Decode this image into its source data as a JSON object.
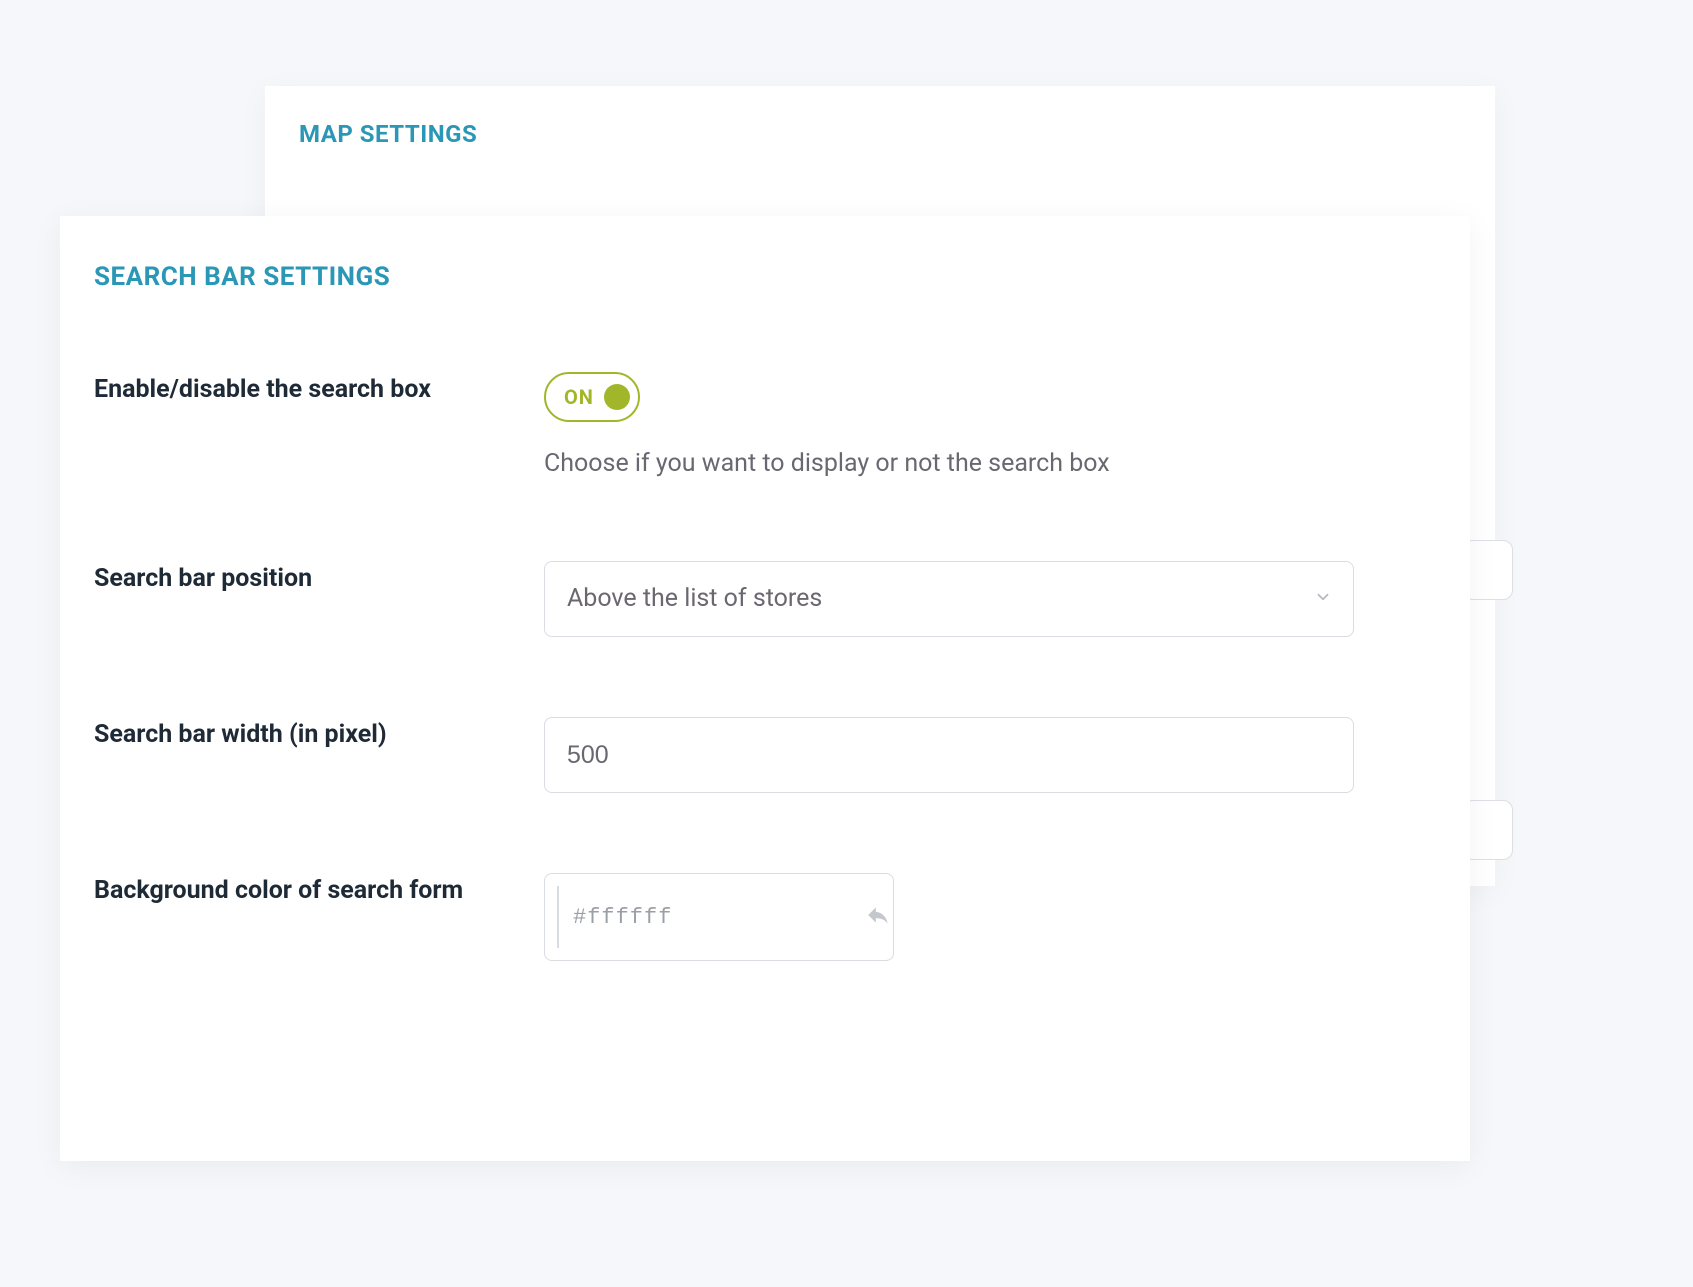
{
  "back_panel": {
    "title": "MAP SETTINGS"
  },
  "front_panel": {
    "title": "SEARCH BAR SETTINGS"
  },
  "fields": {
    "enable_search": {
      "label": "Enable/disable the search box",
      "toggle_label": "ON",
      "help": "Choose if you want to display or not the search box"
    },
    "position": {
      "label": "Search bar position",
      "value": "Above the list of stores"
    },
    "width": {
      "label": "Search bar width (in pixel)",
      "value": "500"
    },
    "bg_color": {
      "label": "Background color of search form",
      "value": "#ffffff"
    }
  }
}
